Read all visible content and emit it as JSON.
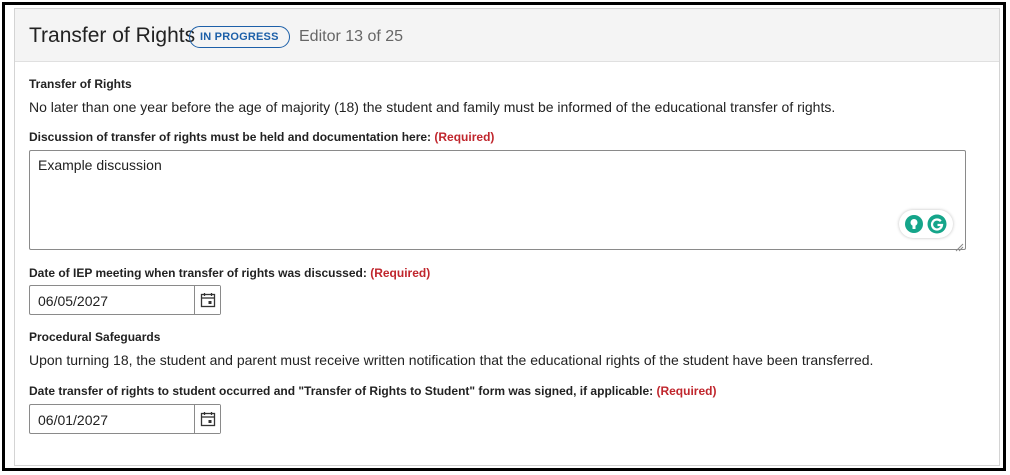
{
  "header": {
    "title": "Transfer of Rights",
    "status_badge": "IN PROGRESS",
    "editor_count": "Editor 13 of 25"
  },
  "section": {
    "heading": "Transfer of Rights",
    "description": "No later than one year before the age of majority (18) the student and family must be informed of the educational transfer of rights."
  },
  "discussion": {
    "label": "Discussion of transfer of rights must be held and documentation here:",
    "required": "(Required)",
    "value": "Example discussion"
  },
  "meeting_date": {
    "label": "Date of IEP meeting when transfer of rights was discussed:",
    "required": "(Required)",
    "value": "06/05/2027"
  },
  "safeguards": {
    "heading": "Procedural Safeguards",
    "description": "Upon turning 18, the student and parent must receive written notification that the educational rights of the student have been transferred."
  },
  "transfer_date": {
    "label": "Date transfer of rights to student occurred and \"Transfer of Rights to Student\" form was signed, if applicable:",
    "required": "(Required)",
    "value": "06/01/2027"
  },
  "icons": {
    "calendar": "calendar-icon",
    "assist_bulb": "lightbulb-icon",
    "grammarly": "grammarly-icon"
  },
  "colors": {
    "badge": "#1c5fa8",
    "required": "#c0262d",
    "assist_green": "#15a58a"
  }
}
